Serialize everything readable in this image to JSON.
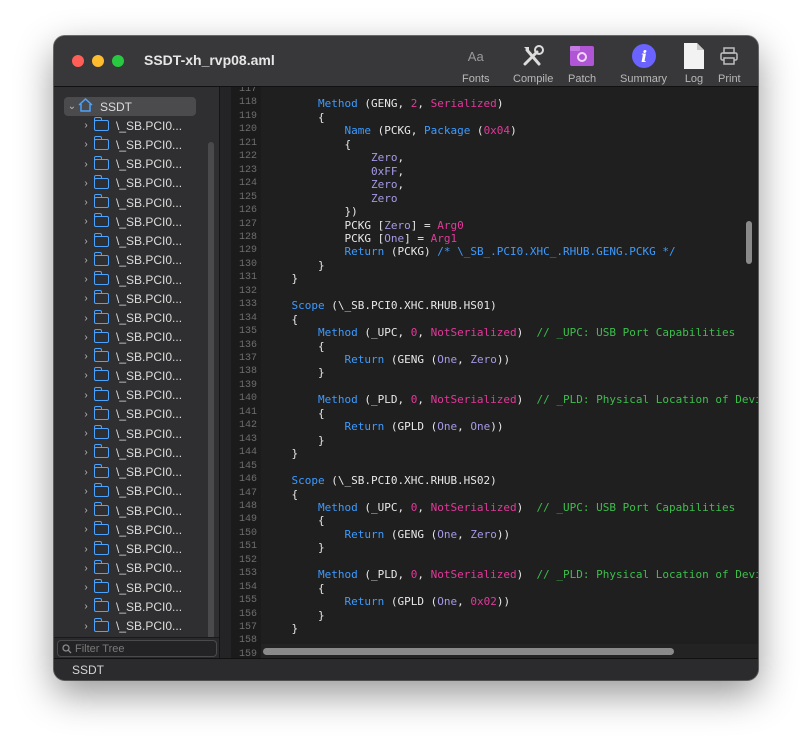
{
  "window": {
    "title": "SSDT-xh_rvp08.aml"
  },
  "toolbar": {
    "fonts": {
      "glyph": "Aa",
      "label": "Fonts",
      "icon": "fonts-icon"
    },
    "compile": {
      "label": "Compile",
      "icon": "tools-icon"
    },
    "patch": {
      "label": "Patch",
      "icon": "patch-icon"
    },
    "summary": {
      "label": "Summary",
      "icon": "info-icon"
    },
    "log": {
      "label": "Log",
      "icon": "document-icon"
    },
    "print": {
      "label": "Print",
      "icon": "printer-icon"
    }
  },
  "sidebar": {
    "root_label": "SSDT",
    "item_label": "\\_SB.PCI0...",
    "item_count": 28,
    "filter_placeholder": "Filter Tree"
  },
  "status": {
    "text": "SSDT"
  },
  "editor": {
    "line_numbers": [
      "117",
      "118",
      "119",
      "120",
      "121",
      "122",
      "123",
      "124",
      "125",
      "126",
      "127",
      "128",
      "129",
      "130",
      "131",
      "132",
      "133",
      "134",
      "135",
      "136",
      "137",
      "138",
      "139",
      "140",
      "141",
      "142",
      "143",
      "144",
      "145",
      "146",
      "147",
      "148",
      "149",
      "150",
      "151",
      "152",
      "153",
      "154",
      "155",
      "156",
      "157",
      "158",
      "159"
    ],
    "lines": [
      {
        "tokens": []
      },
      {
        "tokens": [
          [
            "kw",
            "        Method"
          ],
          [
            "tx",
            " (GENG, "
          ],
          [
            "mg",
            "2"
          ],
          [
            "tx",
            ", "
          ],
          [
            "mg",
            "Serialized"
          ],
          [
            "tx",
            ")"
          ]
        ]
      },
      {
        "tokens": [
          [
            "tx",
            "        {"
          ]
        ]
      },
      {
        "tokens": [
          [
            "kw",
            "            Name"
          ],
          [
            "tx",
            " (PCKG, "
          ],
          [
            "kw",
            "Package"
          ],
          [
            "tx",
            " ("
          ],
          [
            "mg",
            "0x04"
          ],
          [
            "tx",
            ")"
          ]
        ]
      },
      {
        "tokens": [
          [
            "tx",
            "            {"
          ]
        ]
      },
      {
        "tokens": [
          [
            "pp",
            "                Zero"
          ],
          [
            "tx",
            ","
          ]
        ]
      },
      {
        "tokens": [
          [
            "pp",
            "                0xFF"
          ],
          [
            "tx",
            ","
          ]
        ]
      },
      {
        "tokens": [
          [
            "pp",
            "                Zero"
          ],
          [
            "tx",
            ","
          ]
        ]
      },
      {
        "tokens": [
          [
            "pp",
            "                Zero"
          ]
        ]
      },
      {
        "tokens": [
          [
            "tx",
            "            })"
          ]
        ]
      },
      {
        "tokens": [
          [
            "tx",
            "            PCKG ["
          ],
          [
            "pp",
            "Zero"
          ],
          [
            "tx",
            "] = "
          ],
          [
            "mg",
            "Arg0"
          ]
        ]
      },
      {
        "tokens": [
          [
            "tx",
            "            PCKG ["
          ],
          [
            "pp",
            "One"
          ],
          [
            "tx",
            "] = "
          ],
          [
            "mg",
            "Arg1"
          ]
        ]
      },
      {
        "tokens": [
          [
            "kw",
            "            Return"
          ],
          [
            "tx",
            " (PCKG) "
          ],
          [
            "kw",
            "/* \\_SB_.PCI0.XHC_.RHUB.GENG.PCKG */"
          ]
        ]
      },
      {
        "tokens": [
          [
            "tx",
            "        }"
          ]
        ]
      },
      {
        "tokens": [
          [
            "tx",
            "    }"
          ]
        ]
      },
      {
        "tokens": []
      },
      {
        "tokens": [
          [
            "kw",
            "    Scope"
          ],
          [
            "tx",
            " (\\_SB.PCI0.XHC.RHUB.HS01)"
          ]
        ]
      },
      {
        "tokens": [
          [
            "tx",
            "    {"
          ]
        ]
      },
      {
        "tokens": [
          [
            "kw",
            "        Method"
          ],
          [
            "tx",
            " (_UPC, "
          ],
          [
            "mg",
            "0"
          ],
          [
            "tx",
            ", "
          ],
          [
            "mg",
            "NotSerialized"
          ],
          [
            "tx",
            ")  "
          ],
          [
            "cm",
            "// _UPC: USB Port Capabilities"
          ]
        ]
      },
      {
        "tokens": [
          [
            "tx",
            "        {"
          ]
        ]
      },
      {
        "tokens": [
          [
            "kw",
            "            Return"
          ],
          [
            "tx",
            " (GENG ("
          ],
          [
            "pp",
            "One"
          ],
          [
            "tx",
            ", "
          ],
          [
            "pp",
            "Zero"
          ],
          [
            "tx",
            "))"
          ]
        ]
      },
      {
        "tokens": [
          [
            "tx",
            "        }"
          ]
        ]
      },
      {
        "tokens": []
      },
      {
        "tokens": [
          [
            "kw",
            "        Method"
          ],
          [
            "tx",
            " (_PLD, "
          ],
          [
            "mg",
            "0"
          ],
          [
            "tx",
            ", "
          ],
          [
            "mg",
            "NotSerialized"
          ],
          [
            "tx",
            ")  "
          ],
          [
            "cm",
            "// _PLD: Physical Location of Device"
          ]
        ]
      },
      {
        "tokens": [
          [
            "tx",
            "        {"
          ]
        ]
      },
      {
        "tokens": [
          [
            "kw",
            "            Return"
          ],
          [
            "tx",
            " (GPLD ("
          ],
          [
            "pp",
            "One"
          ],
          [
            "tx",
            ", "
          ],
          [
            "pp",
            "One"
          ],
          [
            "tx",
            "))"
          ]
        ]
      },
      {
        "tokens": [
          [
            "tx",
            "        }"
          ]
        ]
      },
      {
        "tokens": [
          [
            "tx",
            "    }"
          ]
        ]
      },
      {
        "tokens": []
      },
      {
        "tokens": [
          [
            "kw",
            "    Scope"
          ],
          [
            "tx",
            " (\\_SB.PCI0.XHC.RHUB.HS02)"
          ]
        ]
      },
      {
        "tokens": [
          [
            "tx",
            "    {"
          ]
        ]
      },
      {
        "tokens": [
          [
            "kw",
            "        Method"
          ],
          [
            "tx",
            " (_UPC, "
          ],
          [
            "mg",
            "0"
          ],
          [
            "tx",
            ", "
          ],
          [
            "mg",
            "NotSerialized"
          ],
          [
            "tx",
            ")  "
          ],
          [
            "cm",
            "// _UPC: USB Port Capabilities"
          ]
        ]
      },
      {
        "tokens": [
          [
            "tx",
            "        {"
          ]
        ]
      },
      {
        "tokens": [
          [
            "kw",
            "            Return"
          ],
          [
            "tx",
            " (GENG ("
          ],
          [
            "pp",
            "One"
          ],
          [
            "tx",
            ", "
          ],
          [
            "pp",
            "Zero"
          ],
          [
            "tx",
            "))"
          ]
        ]
      },
      {
        "tokens": [
          [
            "tx",
            "        }"
          ]
        ]
      },
      {
        "tokens": []
      },
      {
        "tokens": [
          [
            "kw",
            "        Method"
          ],
          [
            "tx",
            " (_PLD, "
          ],
          [
            "mg",
            "0"
          ],
          [
            "tx",
            ", "
          ],
          [
            "mg",
            "NotSerialized"
          ],
          [
            "tx",
            ")  "
          ],
          [
            "cm",
            "// _PLD: Physical Location of Device"
          ]
        ]
      },
      {
        "tokens": [
          [
            "tx",
            "        {"
          ]
        ]
      },
      {
        "tokens": [
          [
            "kw",
            "            Return"
          ],
          [
            "tx",
            " (GPLD ("
          ],
          [
            "pp",
            "One"
          ],
          [
            "tx",
            ", "
          ],
          [
            "mg",
            "0x02"
          ],
          [
            "tx",
            "))"
          ]
        ]
      },
      {
        "tokens": [
          [
            "tx",
            "        }"
          ]
        ]
      },
      {
        "tokens": [
          [
            "tx",
            "    }"
          ]
        ]
      },
      {
        "tokens": []
      },
      {
        "tokens": []
      }
    ]
  },
  "colors": {
    "keyword": "#3d9bff",
    "text": "#e8e8e8",
    "magenta": "#e2399a",
    "constant": "#a59ae5",
    "comment": "#3dbe4d",
    "folder": "#4aa3ff",
    "patch": "#b055d6",
    "info": "#6b63ff"
  }
}
